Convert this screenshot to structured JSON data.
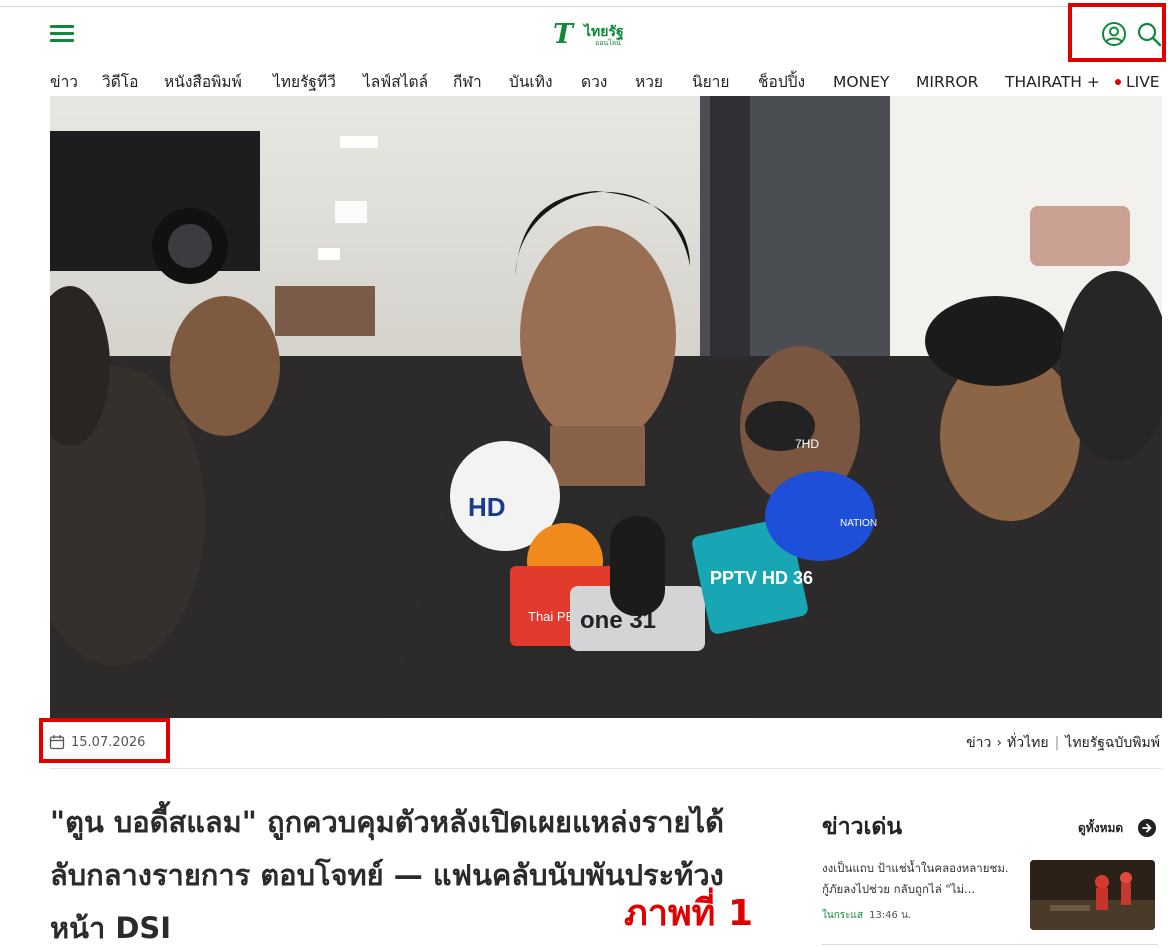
{
  "header": {
    "logo_mark": "T",
    "logo_name": "ไทยรัฐ",
    "logo_sub": "ออนไลน์"
  },
  "nav": {
    "items": [
      "ข่าว",
      "วิดีโอ",
      "หนังสือพิมพ์",
      "ไทยรัฐทีวี",
      "ไลฟ์สไตล์",
      "กีฬา",
      "บันเทิง",
      "ดวง",
      "หวย",
      "นิยาย",
      "ช็อปปิ้ง",
      "MONEY",
      "MIRROR",
      "THAIRATH +",
      "LIVE"
    ]
  },
  "hero": {
    "mic_labels": [
      "HD",
      "Thai PBS",
      "one 31",
      "PPTV HD 36",
      "NATION",
      "7HD"
    ]
  },
  "article": {
    "date": "15.07.2026",
    "breadcrumb": [
      "ข่าว",
      "ทั่วไทย",
      "ไทยรัฐฉบับพิมพ์"
    ],
    "headline": "\"ตูน บอดี้สแลม\" ถูกควบคุมตัวหลังเปิดเผยแหล่งรายได้ลับกลางรายการ ตอบโจทย์ — แฟนคลับนับพันประท้วงหน้า DSI",
    "overlay_label": "ภาพที่ 1"
  },
  "trending": {
    "title": "ข่าวเด่น",
    "see_all": "ดูทั้งหมด",
    "items": [
      {
        "text": "งงเป็นแถบ ป้าแช่น้ำในคลองหลายชม. กู้ภัยลงไปช่วย กลับถูกไล่ \"ไม่...",
        "category": "ในกระแส",
        "time": "13:46 น."
      }
    ]
  },
  "colors": {
    "brand_green": "#0e8a3a",
    "highlight_red": "#e00000",
    "live_red": "#e00000"
  },
  "icons": [
    "hamburger-menu-icon",
    "user-account-icon",
    "search-icon",
    "calendar-icon",
    "chevron-right-icon",
    "arrow-right-circle-icon"
  ]
}
